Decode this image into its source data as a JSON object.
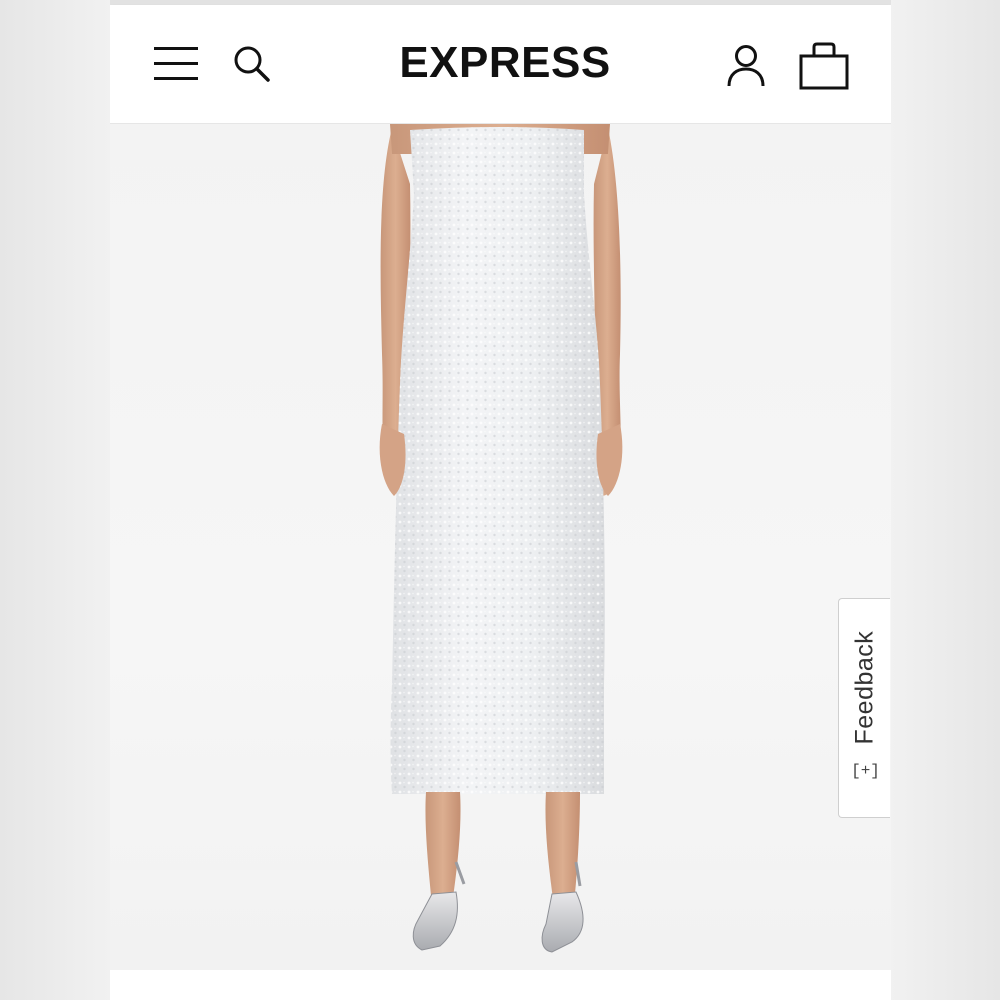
{
  "header": {
    "logo_text": "EXPRESS",
    "icons": {
      "menu": "hamburger-menu-icon",
      "search": "search-icon",
      "account": "user-icon",
      "bag": "shopping-bag-icon"
    }
  },
  "product_image": {
    "subject": "model wearing white sequin strapless midi dress with silver pointed heels"
  },
  "feedback": {
    "label": "Feedback",
    "icon_glyph": "[+]"
  },
  "colors": {
    "brand": "#111111",
    "background": "#f4f4f4",
    "dress": "#eceef0",
    "skin": "#d9a98a"
  }
}
